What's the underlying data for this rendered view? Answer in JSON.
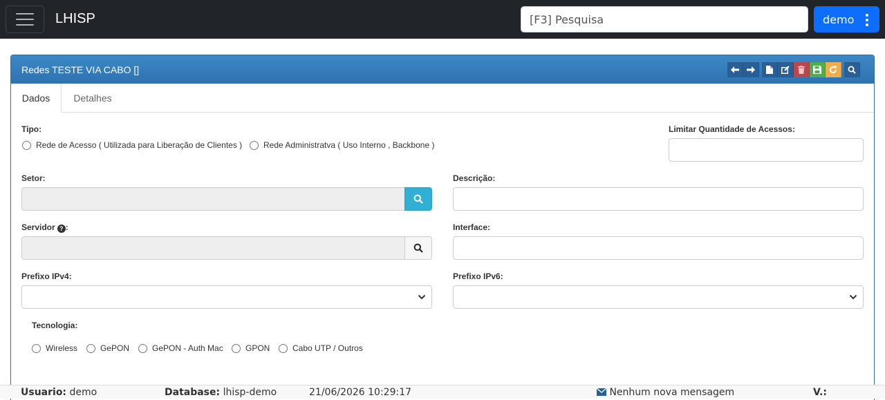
{
  "navbar": {
    "brand": "LHISP",
    "search_placeholder": "[F3] Pesquisa",
    "user_label": "demo"
  },
  "panel": {
    "title": "Redes TESTE VIA CABO []",
    "toolbar": [
      "arrow-left-icon",
      "arrow-right-icon",
      "new-file-icon",
      "edit-icon",
      "trash-icon",
      "save-icon",
      "refresh-icon",
      "search-icon"
    ]
  },
  "tabs": [
    {
      "label": "Dados",
      "active": true
    },
    {
      "label": "Detalhes",
      "active": false
    }
  ],
  "form": {
    "tipo_label": "Tipo:",
    "tipo_options": [
      "Rede de Acesso ( Utilizada para Liberação de Clientes )",
      "Rede Administratva ( Uso Interno , Backbone )"
    ],
    "limitar_label": "Limitar Quantidade de Acessos:",
    "limitar_value": "",
    "setor_label": "Setor:",
    "setor_value": "",
    "descricao_label": "Descrição:",
    "descricao_value": "",
    "servidor_label": "Servidor",
    "servidor_suffix": ":",
    "servidor_value": "",
    "interface_label": "Interface:",
    "interface_value": "",
    "prefixo_ipv4_label": "Prefixo IPv4:",
    "prefixo_ipv4_value": "",
    "prefixo_ipv6_label": "Prefixo IPv6:",
    "prefixo_ipv6_value": "",
    "tecnologia_label": "Tecnologia:",
    "tecnologia_options": [
      "Wireless",
      "GePON",
      "GePON - Auth Mac",
      "GPON",
      "Cabo UTP / Outros"
    ]
  },
  "footer": {
    "usuario_label": "Usuario:",
    "usuario_value": "demo",
    "database_label": "Database:",
    "database_value": "lhisp-demo",
    "datetime": "21/06/2026 10:29:17",
    "messages": "Nenhum nova mensagem",
    "version_label": "V.:"
  },
  "colors": {
    "navbar": "#212529",
    "primary_button": "#0d6efd",
    "panel_heading": "#337ab7",
    "delete": "#b9474e",
    "save": "#4cae4c",
    "refresh": "#f0ad4e",
    "info_button": "#31b0d5"
  }
}
